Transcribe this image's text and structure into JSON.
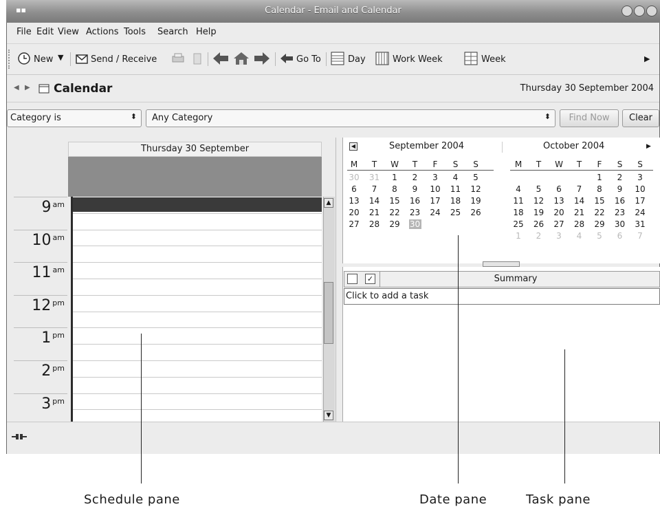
{
  "window": {
    "title": "Calendar - Email and Calendar"
  },
  "menubar": {
    "items": [
      "File",
      "Edit",
      "View",
      "Actions",
      "Tools",
      "Search",
      "Help"
    ]
  },
  "toolbar": {
    "new_label": "New",
    "send_receive_label": "Send / Receive",
    "goto_label": "Go To",
    "day_label": "Day",
    "work_week_label": "Work Week",
    "week_label": "Week"
  },
  "header": {
    "component_title": "Calendar",
    "current_date": "Thursday 30 September 2004"
  },
  "searchbar": {
    "filter_field": "Category is",
    "filter_value": "Any Category",
    "find_now_label": "Find Now",
    "clear_label": "Clear"
  },
  "schedule": {
    "day_heading": "Thursday 30 September",
    "hours": [
      {
        "h": "9",
        "ap": "am"
      },
      {
        "h": "10",
        "ap": "am"
      },
      {
        "h": "11",
        "ap": "am"
      },
      {
        "h": "12",
        "ap": "pm"
      },
      {
        "h": "1",
        "ap": "pm"
      },
      {
        "h": "2",
        "ap": "pm"
      },
      {
        "h": "3",
        "ap": "pm"
      }
    ]
  },
  "date_pane": {
    "month1": "September 2004",
    "month2": "October 2004",
    "dow": [
      "M",
      "T",
      "W",
      "T",
      "F",
      "S",
      "S"
    ],
    "sep_weeks": [
      [
        "30",
        "31",
        "1",
        "2",
        "3",
        "4",
        "5"
      ],
      [
        "6",
        "7",
        "8",
        "9",
        "10",
        "11",
        "12"
      ],
      [
        "13",
        "14",
        "15",
        "16",
        "17",
        "18",
        "19"
      ],
      [
        "20",
        "21",
        "22",
        "23",
        "24",
        "25",
        "26"
      ],
      [
        "27",
        "28",
        "29",
        "30",
        "",
        "",
        ""
      ]
    ],
    "oct_weeks": [
      [
        "",
        "",
        "",
        "",
        "1",
        "2",
        "3"
      ],
      [
        "4",
        "5",
        "6",
        "7",
        "8",
        "9",
        "10"
      ],
      [
        "11",
        "12",
        "13",
        "14",
        "15",
        "16",
        "17"
      ],
      [
        "18",
        "19",
        "20",
        "21",
        "22",
        "23",
        "24"
      ],
      [
        "25",
        "26",
        "27",
        "28",
        "29",
        "30",
        "31"
      ],
      [
        "1",
        "2",
        "3",
        "4",
        "5",
        "6",
        "7"
      ]
    ]
  },
  "task_pane": {
    "summary_header": "Summary",
    "add_task_text": "Click to add a task"
  },
  "callouts": {
    "schedule": "Schedule pane",
    "date": "Date pane",
    "task": "Task pane"
  }
}
